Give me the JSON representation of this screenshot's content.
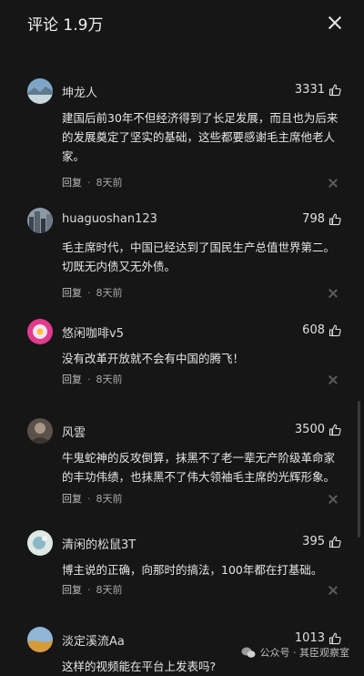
{
  "header": {
    "title": "评论 1.9万"
  },
  "comments": [
    {
      "user": "坤龙人",
      "likes": "3331",
      "text": "建国后前30年不但经济得到了长足发展，而且也为后来的发展奠定了坚实的基础，这些都要感谢毛主席他老人家。",
      "reply": "回复",
      "time": "8天前",
      "avatar": "landscape-avatar"
    },
    {
      "user": "huaguoshan123",
      "likes": "798",
      "text": "毛主席时代，中国已经达到了国民生产总值世界第二。切既无内债又无外债。",
      "reply": "回复",
      "time": "8天前",
      "avatar": "city-avatar"
    },
    {
      "user": "悠闲咖啡v5",
      "likes": "608",
      "text": "没有改革开放就不会有中国的腾飞！",
      "reply": "回复",
      "time": "8天前",
      "avatar": "flower-avatar"
    },
    {
      "user": "风雲",
      "likes": "3500",
      "text": "牛鬼蛇神的反攻倒算，抹黑不了老一辈无产阶级革命家的丰功伟绩，也抹黑不了伟大领袖毛主席的光辉形象。",
      "reply": "回复",
      "time": "8天前",
      "avatar": "portrait-avatar"
    },
    {
      "user": "清闲的松鼠3T",
      "likes": "395",
      "text": "博主说的正确，向那时的搞法，100年都在打基础。",
      "reply": "回复",
      "time": "8天前",
      "avatar": "cartoon-avatar"
    },
    {
      "user": "淡定溪流Aa",
      "likes": "1013",
      "text": "这样的视频能在平台上发表吗?",
      "reply": "",
      "time": "",
      "avatar": "desert-avatar"
    }
  ],
  "watermark": {
    "text": "公众号 · 其臣观察室"
  }
}
